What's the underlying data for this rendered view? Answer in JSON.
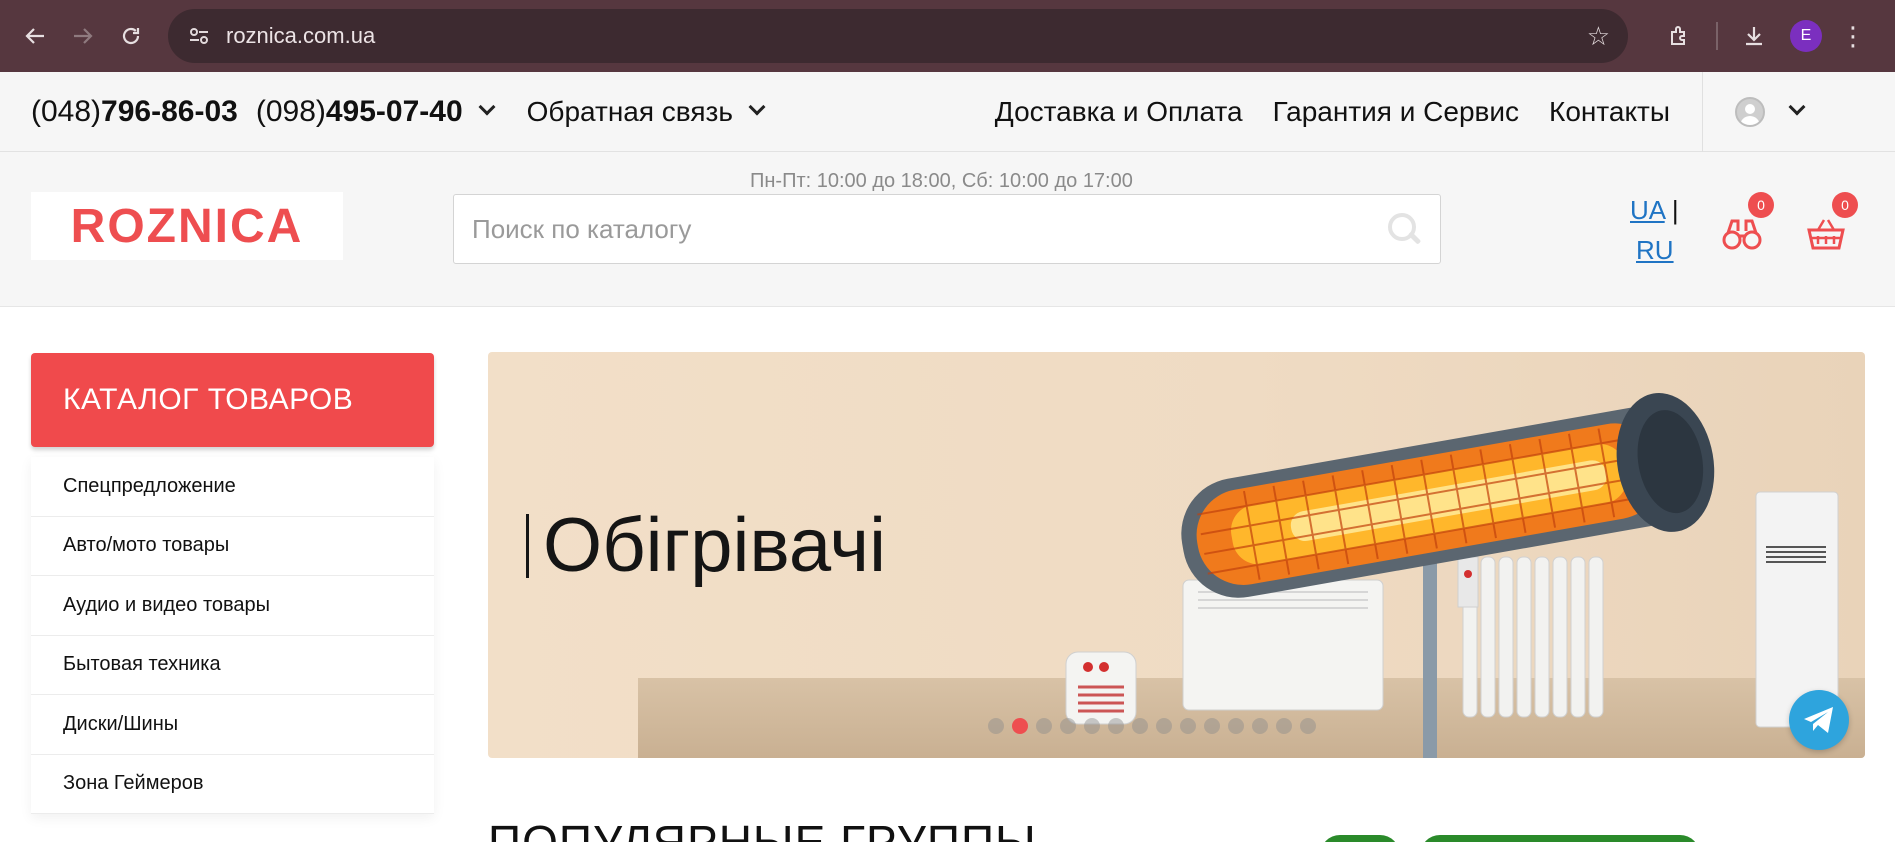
{
  "browser": {
    "url": "roznica.com.ua",
    "profile_initial": "E"
  },
  "topbar": {
    "phone1_code": "(048)",
    "phone1_number": "796-86-03",
    "phone2_code": "(098)",
    "phone2_number": "495-07-40",
    "feedback_label": "Обратная связь",
    "nav": [
      "Доставка и Оплата",
      "Гарантия и Сервис",
      "Контакты"
    ]
  },
  "header": {
    "hours": "Пн-Пт: 10:00 до 18:00, Сб: 10:00 до 17:00",
    "logo_text": "ROZNICA",
    "search_placeholder": "Поиск по каталогу",
    "lang_ua": "UA",
    "lang_sep": "|",
    "lang_ru": "RU",
    "compare_count": "0",
    "cart_count": "0"
  },
  "catalog": {
    "button_label": "КАТАЛОГ ТОВАРОВ",
    "items": [
      "Спецпредложение",
      "Авто/мото товары",
      "Аудио и видео товары",
      "Бытовая техника",
      "Диски/Шины",
      "Зона Геймеров"
    ]
  },
  "banner": {
    "title": "Обігрівачі",
    "slide_count": 14,
    "active_slide": 2
  },
  "section": {
    "title": "ПОПУЛЯРНЫЕ ГРУППЫ"
  },
  "colors": {
    "accent": "#ee4e50",
    "chrome": "#56373f",
    "telegram": "#2ea4dd"
  }
}
